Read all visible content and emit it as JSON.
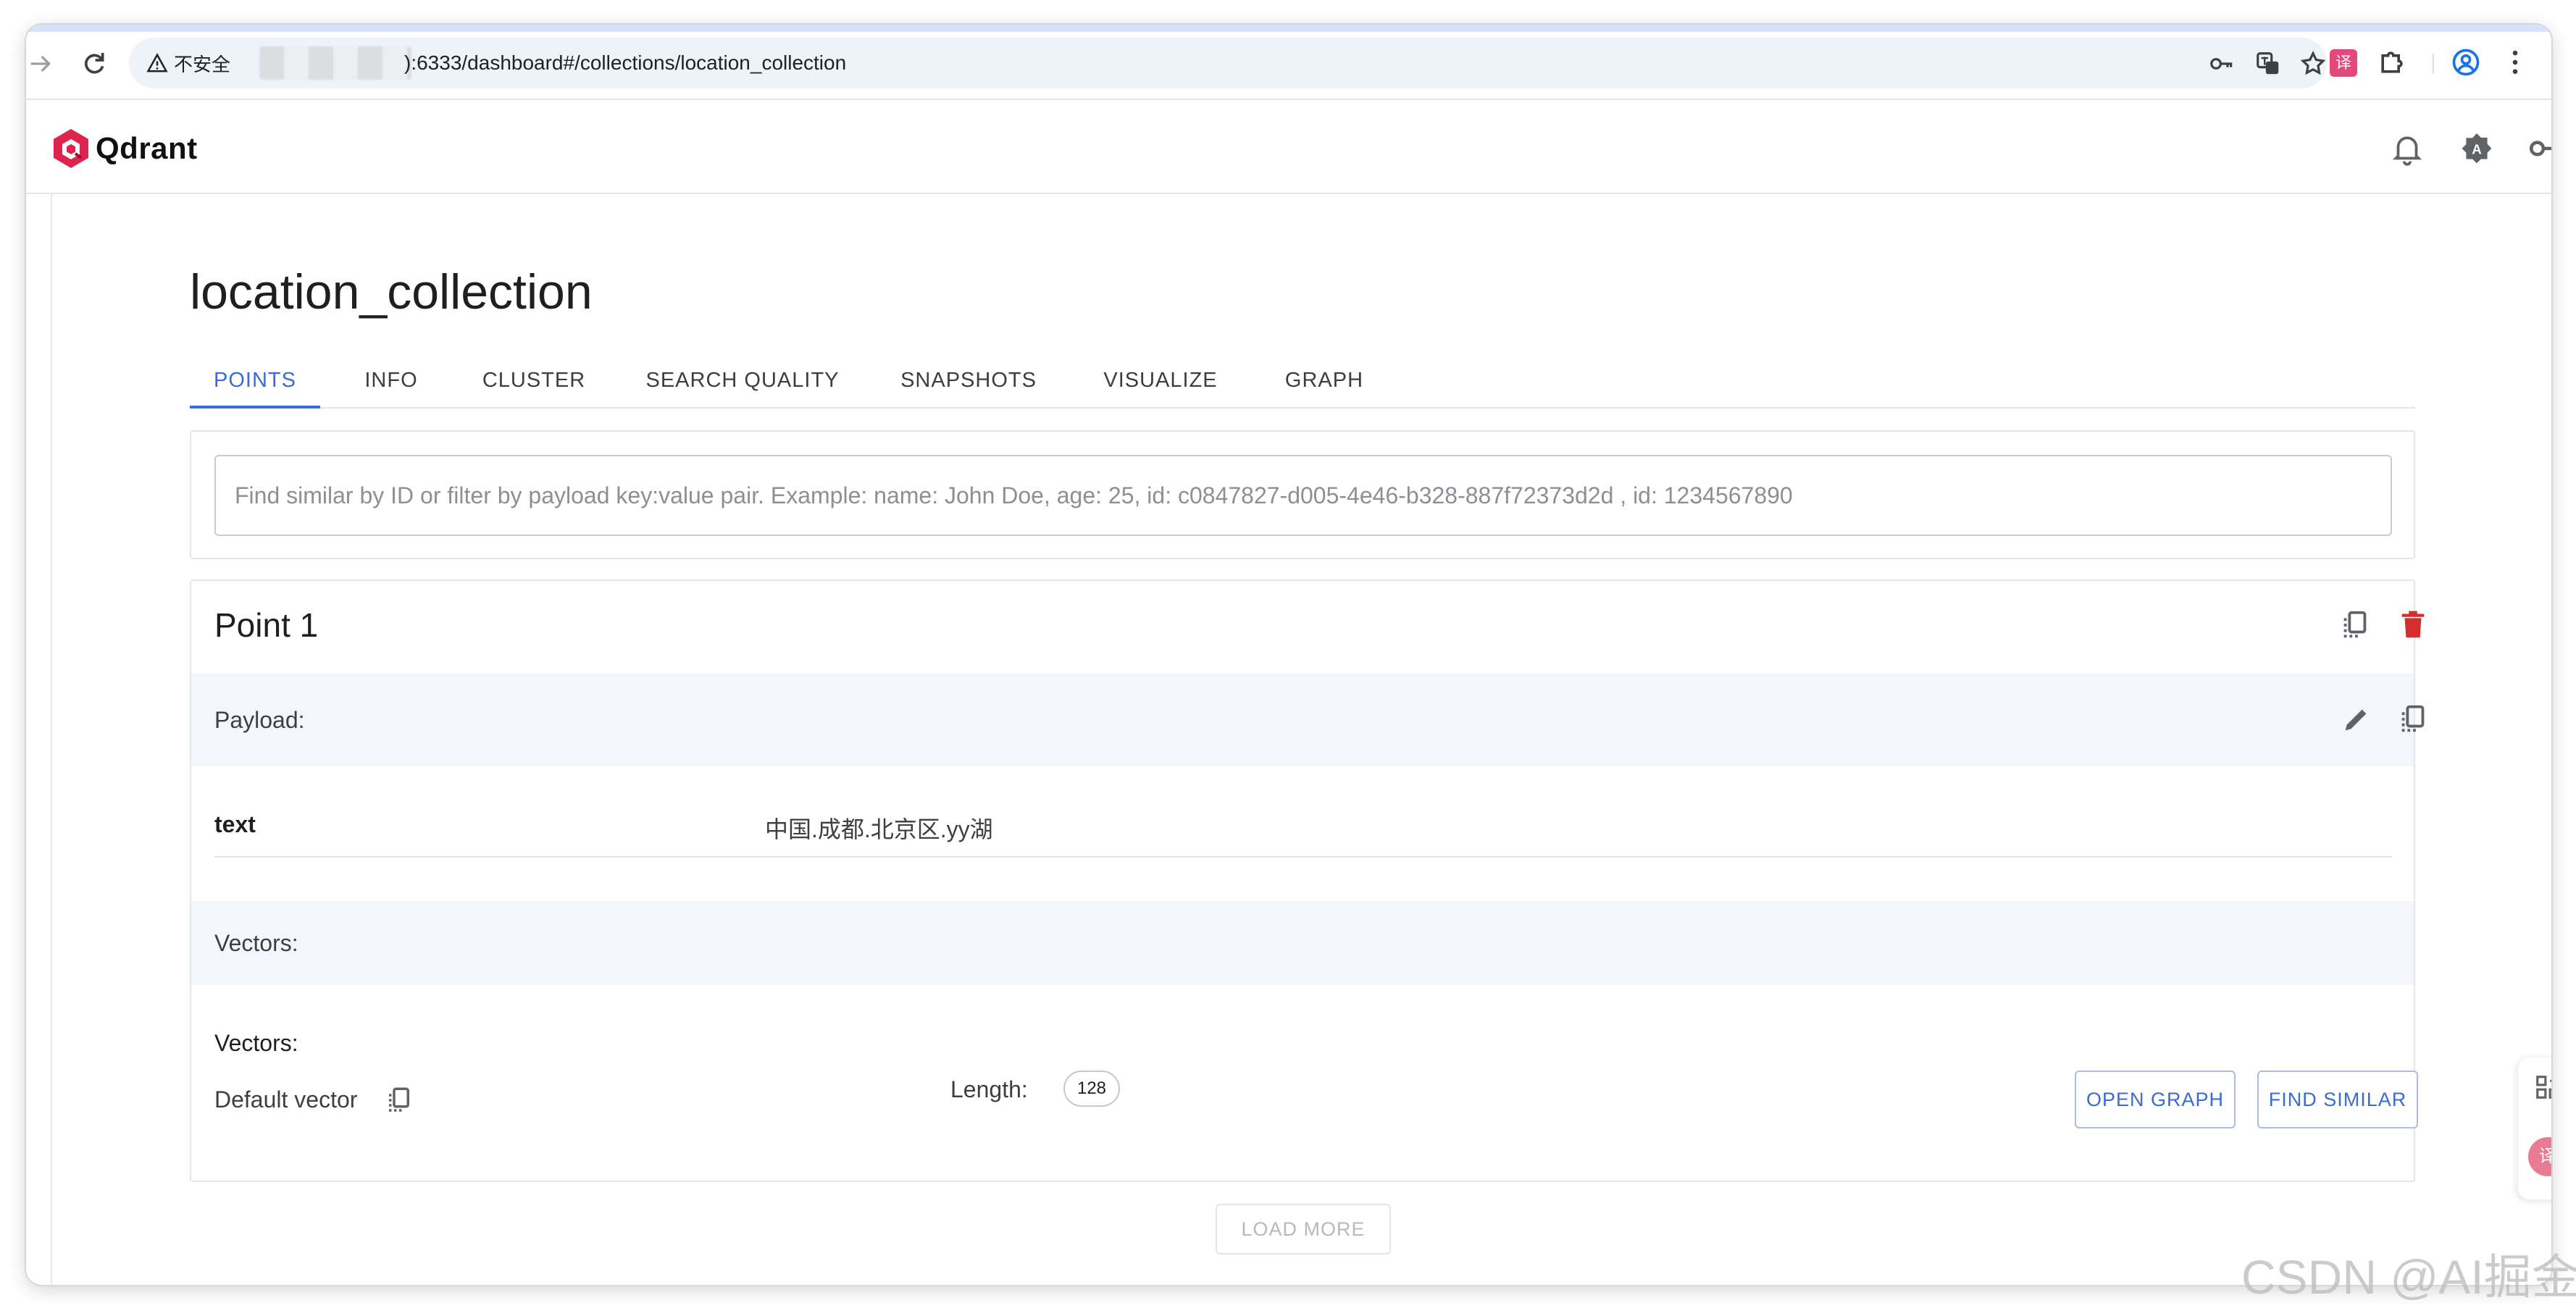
{
  "browser": {
    "security_label": "不安全",
    "url": "):6333/dashboard#/collections/location_collection",
    "icons": [
      "forward-icon",
      "reload-icon",
      "key-icon",
      "translate-icon",
      "star-icon",
      "extension-translate-icon",
      "extensions-icon",
      "profile-icon",
      "menu-icon"
    ]
  },
  "app": {
    "brand": "Qdrant",
    "brand_color": "#dc244c",
    "accent_color": "#3a6bd6",
    "header_icons": [
      "bell-icon",
      "theme-icon",
      "api-key-icon"
    ]
  },
  "page": {
    "title": "location_collection",
    "tabs": [
      {
        "label": "POINTS",
        "active": true
      },
      {
        "label": "INFO",
        "active": false
      },
      {
        "label": "CLUSTER",
        "active": false
      },
      {
        "label": "SEARCH QUALITY",
        "active": false
      },
      {
        "label": "SNAPSHOTS",
        "active": false
      },
      {
        "label": "VISUALIZE",
        "active": false
      },
      {
        "label": "GRAPH",
        "active": false
      }
    ]
  },
  "search": {
    "placeholder": "Find similar by ID or filter by payload key:value pair. Example: name: John Doe, age: 25, id: c0847827-d005-4e46-b328-887f72373d2d , id: 1234567890",
    "value": ""
  },
  "point": {
    "title": "Point 1",
    "payload_label": "Payload:",
    "payload": [
      {
        "key": "text",
        "value": "中国.成都.北京区.yy湖"
      }
    ],
    "vectors_label": "Vectors:",
    "vectors_sub_label": "Vectors:",
    "vector": {
      "name": "Default vector",
      "length_label": "Length:",
      "length": "128"
    },
    "open_graph_label": "OPEN GRAPH",
    "find_similar_label": "FIND SIMILAR"
  },
  "load_more_label": "LOAD MORE",
  "watermark": "CSDN @AI掘金"
}
